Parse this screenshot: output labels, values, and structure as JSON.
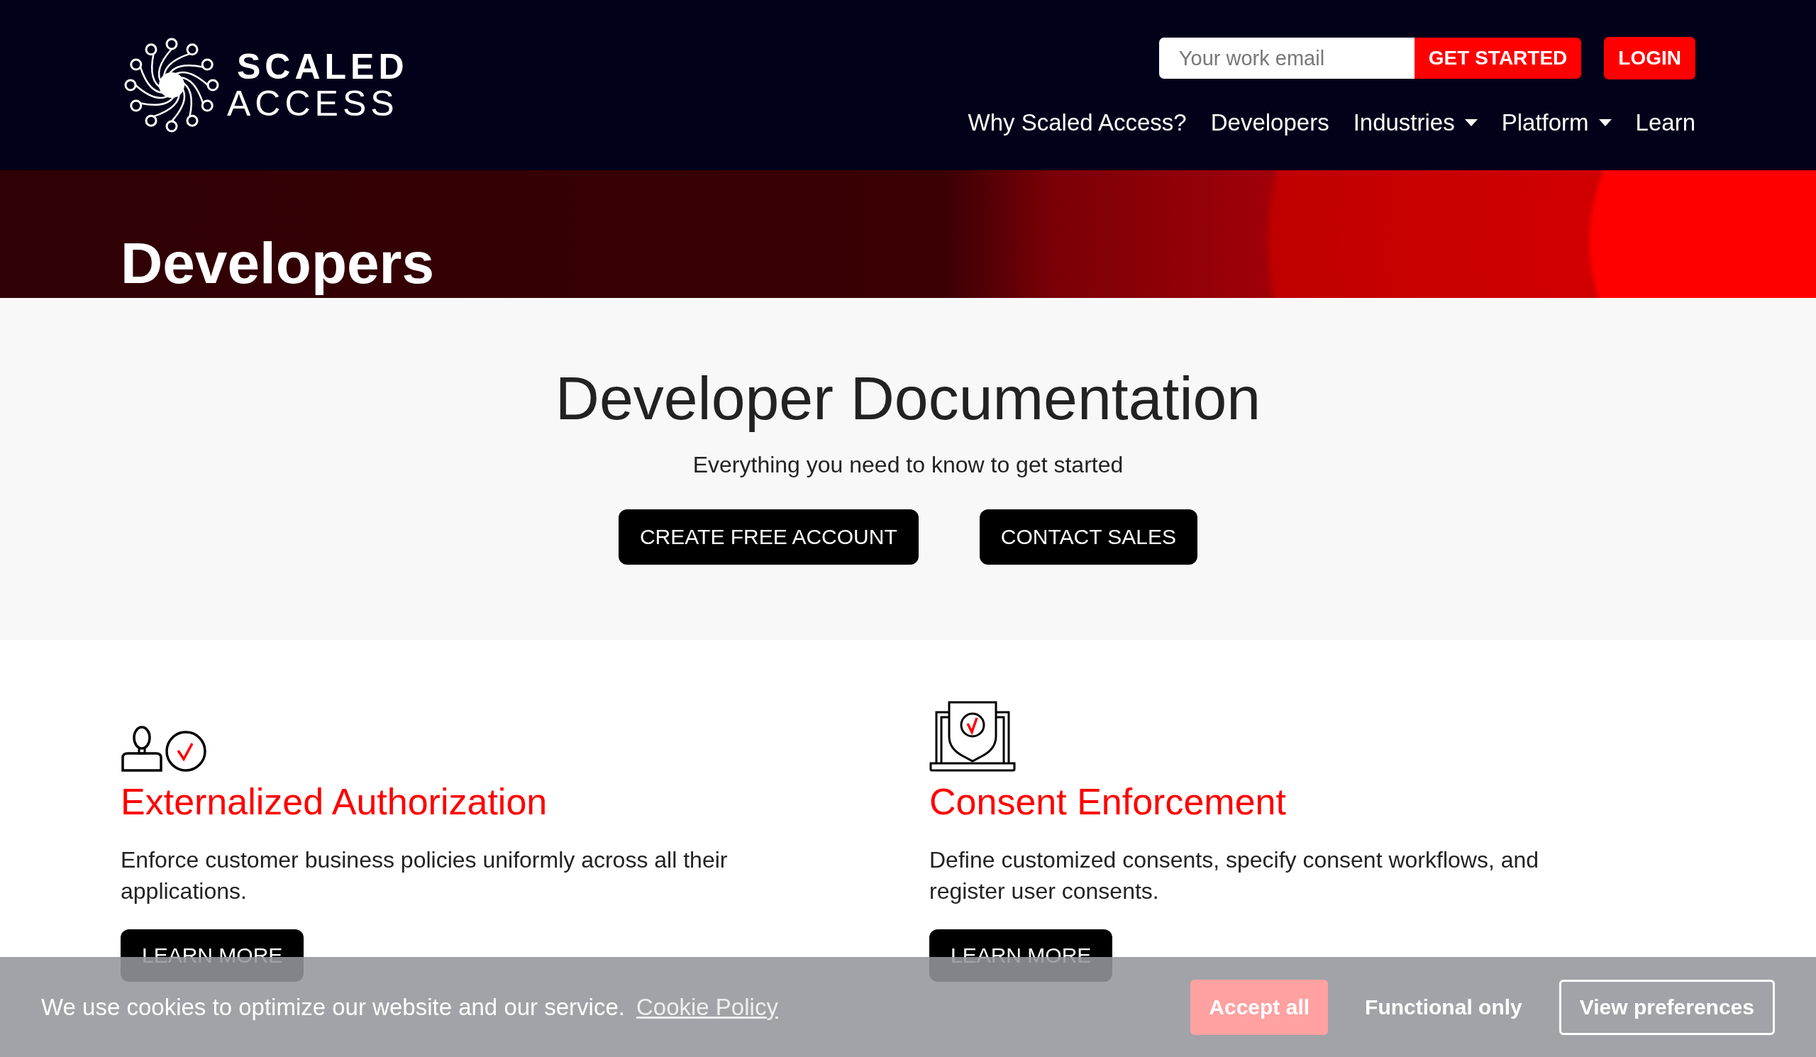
{
  "header": {
    "logo": {
      "line1": "SCALED",
      "line2": "ACCESS"
    },
    "email_field": {
      "placeholder": "Your work email"
    },
    "get_started": "GET STARTED",
    "login": "LOGIN",
    "nav": [
      {
        "label": "Why Scaled Access?",
        "dropdown": false
      },
      {
        "label": "Developers",
        "dropdown": false
      },
      {
        "label": "Industries",
        "dropdown": true
      },
      {
        "label": "Platform",
        "dropdown": true
      },
      {
        "label": "Learn",
        "dropdown": false
      }
    ]
  },
  "hero": {
    "title": "Developers"
  },
  "intro": {
    "title": "Developer Documentation",
    "subtitle": "Everything you need to know to get started",
    "buttons": [
      "CREATE FREE ACCOUNT",
      "CONTACT SALES"
    ]
  },
  "features": [
    {
      "kind": "user-check",
      "title": "Externalized Authorization",
      "text": "Enforce customer business policies uniformly across all their applications.",
      "button": "LEARN MORE"
    },
    {
      "kind": "laptop-shield",
      "title": "Consent Enforcement",
      "text": "Define customized consents, specify consent workflows, and register user consents.",
      "button": "LEARN MORE"
    }
  ],
  "cookie_bar": {
    "text": "We use cookies to optimize our website and our service.",
    "link": "Cookie Policy",
    "buttons": [
      {
        "label": "Accept all",
        "kind": "filled"
      },
      {
        "label": "Functional only",
        "kind": "plain"
      },
      {
        "label": "View preferences",
        "kind": "outlined"
      }
    ]
  }
}
